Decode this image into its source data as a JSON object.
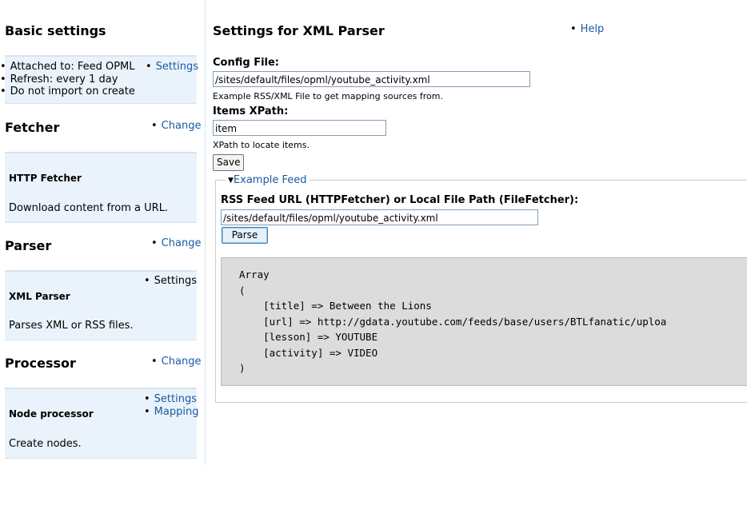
{
  "sidebar": {
    "basic": {
      "title": "Basic settings",
      "attached": "Attached to: Feed OPML",
      "settings_link": "Settings",
      "refresh": "Refresh: every 1 day",
      "import": "Do not import on create"
    },
    "fetcher": {
      "title": "Fetcher",
      "change_link": "Change",
      "name": "HTTP Fetcher",
      "description": "Download content from a URL."
    },
    "parser": {
      "title": "Parser",
      "change_link": "Change",
      "settings_label": "Settings",
      "name": "XML Parser",
      "description": "Parses XML or RSS files."
    },
    "processor": {
      "title": "Processor",
      "change_link": "Change",
      "settings_link": "Settings",
      "mapping_link": "Mapping",
      "name": "Node processor",
      "description": "Create nodes."
    }
  },
  "main": {
    "title": "Settings for XML Parser",
    "help_link": "Help",
    "config_label": "Config File:",
    "config_value": "/sites/default/files/opml/youtube_activity.xml",
    "config_desc": "Example RSS/XML File to get mapping sources from.",
    "xpath_label": "Items XPath:",
    "xpath_value": "item",
    "xpath_desc": "XPath to locate items.",
    "save_button": "Save",
    "example_feed": {
      "legend": "Example Feed",
      "url_label": "RSS Feed URL (HTTPFetcher) or Local File Path (FileFetcher):",
      "url_value": "/sites/default/files/opml/youtube_activity.xml",
      "parse_button": "Parse",
      "output": {
        "line1": "Array",
        "line2": "(",
        "line3": "    [title] => Between the Lions",
        "line4": "    [url] => http://gdata.youtube.com/feeds/base/users/BTLfanatic/uploa",
        "line5": "    [lesson] => YOUTUBE",
        "line6": "    [activity] => VIDEO",
        "line7": ")"
      }
    }
  }
}
